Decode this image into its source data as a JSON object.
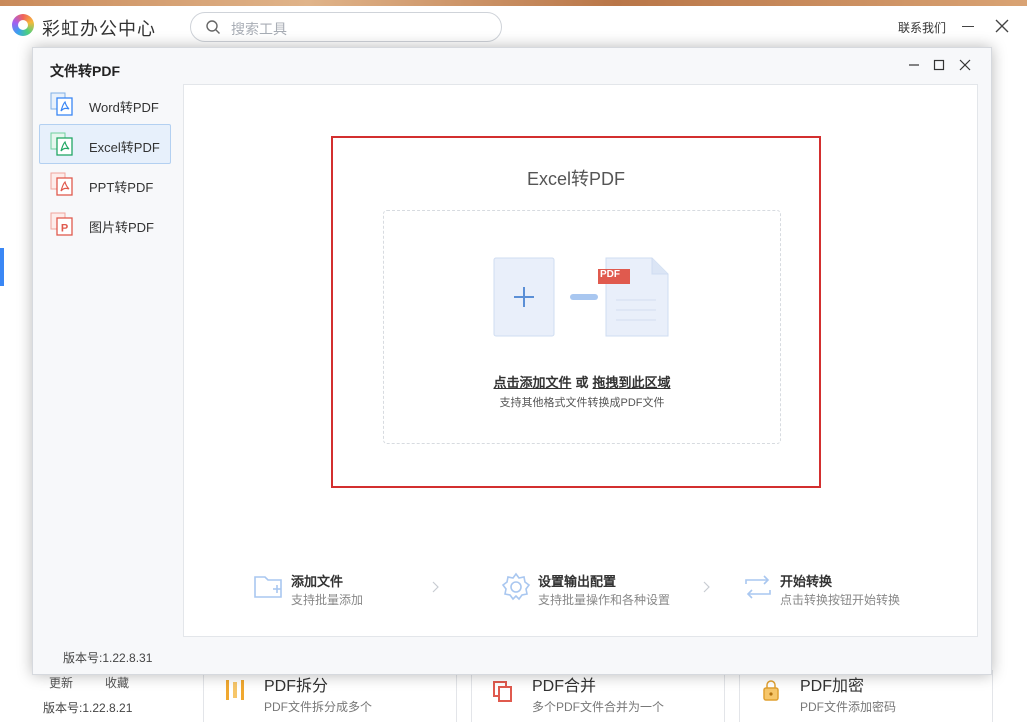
{
  "bg_app": {
    "name": "彩虹办公中心",
    "search_placeholder": "搜索工具",
    "contact": "联系我们",
    "footer": {
      "update": "更新",
      "favorites": "收藏",
      "version": "版本号:1.22.8.21"
    },
    "cards": [
      {
        "title": "PDF拆分",
        "desc": "PDF文件拆分成多个"
      },
      {
        "title": "PDF合并",
        "desc": "多个PDF文件合并为一个"
      },
      {
        "title": "PDF加密",
        "desc": "PDF文件添加密码"
      }
    ]
  },
  "dialog": {
    "title": "文件转PDF",
    "nav": [
      {
        "label": "Word转PDF",
        "active": false
      },
      {
        "label": "Excel转PDF",
        "active": true
      },
      {
        "label": "PPT转PDF",
        "active": false
      },
      {
        "label": "图片转PDF",
        "active": false
      }
    ],
    "version": "版本号:1.22.8.31",
    "dropzone": {
      "title": "Excel转PDF",
      "pdf_badge": "PDF",
      "action_add": "点击添加文件",
      "action_or": "或",
      "action_drag": "拖拽到此区域",
      "hint": "支持其他格式文件转换成PDF文件"
    },
    "steps": [
      {
        "title": "添加文件",
        "desc": "支持批量添加"
      },
      {
        "title": "设置输出配置",
        "desc": "支持批量操作和各种设置"
      },
      {
        "title": "开始转换",
        "desc": "点击转换按钮开始转换"
      }
    ]
  },
  "colors": {
    "accent": "#3a87f5",
    "highlight_border": "#d32f2f",
    "pdf_red": "#e05a4e",
    "nav_active_bg": "#e7f0fb"
  }
}
